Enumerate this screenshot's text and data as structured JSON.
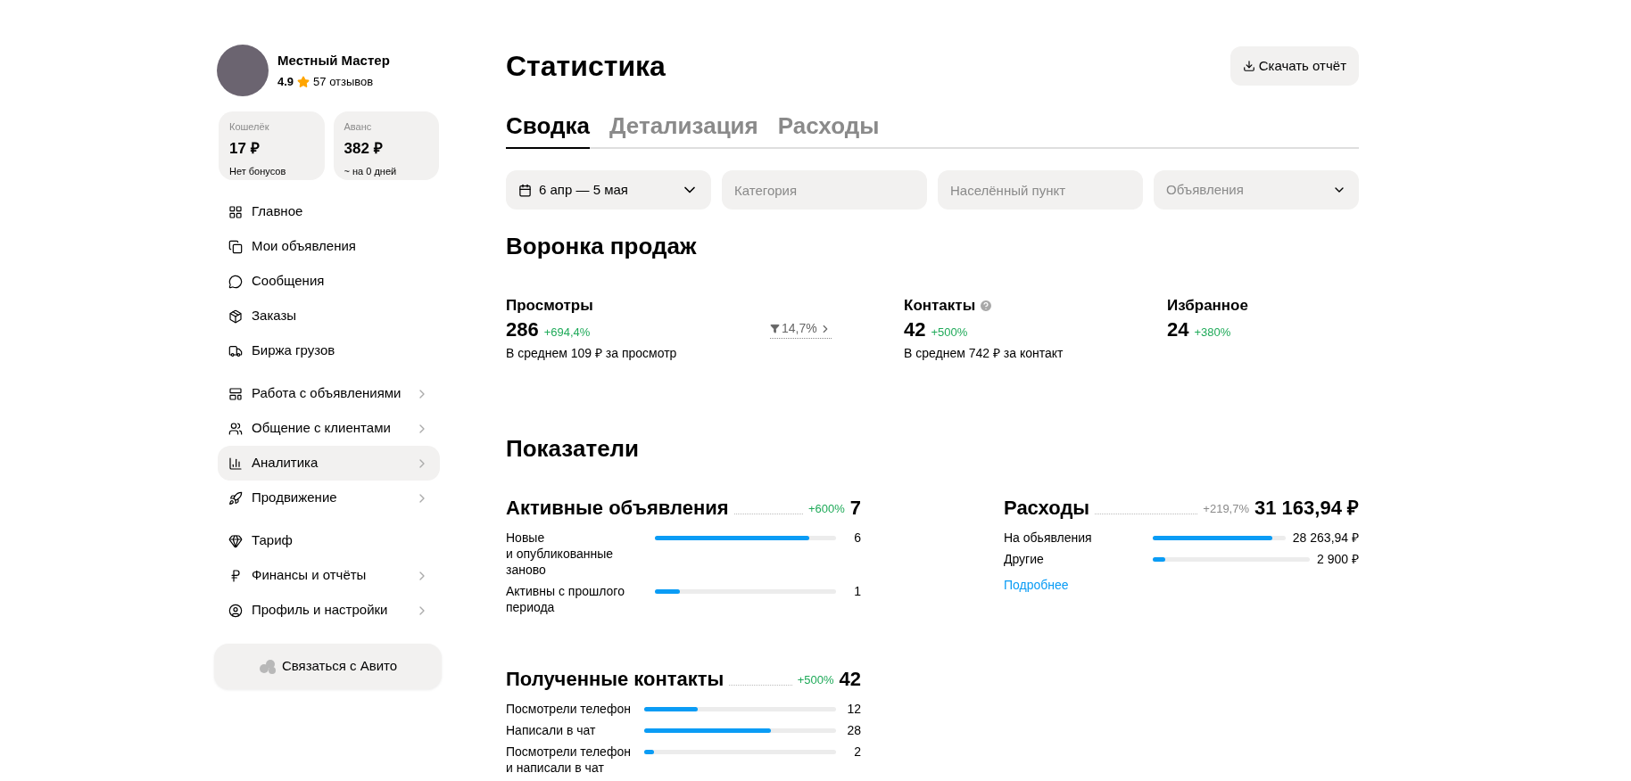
{
  "profile": {
    "name": "Местный Мастер",
    "rating": "4.9",
    "reviews": "57 отзывов"
  },
  "wallets": [
    {
      "label": "Кошелёк",
      "amount": "17 ₽",
      "note": "Нет бонусов"
    },
    {
      "label": "Аванс",
      "amount": "382 ₽",
      "note": "~ на 0 дней"
    }
  ],
  "nav_groups": [
    [
      {
        "label": "Главное",
        "selected": false,
        "expandable": false
      },
      {
        "label": "Мои объявления",
        "selected": false,
        "expandable": false
      },
      {
        "label": "Сообщения",
        "selected": false,
        "expandable": false
      },
      {
        "label": "Заказы",
        "selected": false,
        "expandable": false
      },
      {
        "label": "Биржа грузов",
        "selected": false,
        "expandable": false
      }
    ],
    [
      {
        "label": "Работа с объявлениями",
        "selected": false,
        "expandable": true
      },
      {
        "label": "Общение с клиентами",
        "selected": false,
        "expandable": true
      },
      {
        "label": "Аналитика",
        "selected": true,
        "expandable": true
      },
      {
        "label": "Продвижение",
        "selected": false,
        "expandable": true
      }
    ],
    [
      {
        "label": "Тариф",
        "selected": false,
        "expandable": false
      },
      {
        "label": "Финансы и отчёты",
        "selected": false,
        "expandable": true
      },
      {
        "label": "Профиль и настройки",
        "selected": false,
        "expandable": true
      }
    ]
  ],
  "contact_button": "Связаться с Авито",
  "title": "Статистика",
  "download_button": "Скачать отчёт",
  "tabs": [
    {
      "label": "Сводка",
      "selected": true
    },
    {
      "label": "Детализация",
      "selected": false
    },
    {
      "label": "Расходы",
      "selected": false
    }
  ],
  "filters": [
    {
      "kind": "date",
      "value": "6 апр — 5 мая"
    },
    {
      "kind": "input",
      "placeholder": "Категория"
    },
    {
      "kind": "input",
      "placeholder": "Населённый пункт"
    },
    {
      "kind": "select",
      "placeholder": "Объявления"
    }
  ],
  "funnel": {
    "title": "Воронка продаж",
    "conversion": "14,7%",
    "items": [
      {
        "label": "Просмотры",
        "value": "286",
        "change": "+694,4%",
        "note": "В среднем 109 ₽ за просмотр",
        "info": false
      },
      {
        "label": "Контакты",
        "value": "42",
        "change": "+500%",
        "note": "В среднем 742 ₽ за контакт",
        "info": true
      },
      {
        "label": "Избранное",
        "value": "24",
        "change": "+380%",
        "info": false
      }
    ]
  },
  "metrics": {
    "title": "Показатели",
    "sections": [
      {
        "title": "Активные объявления",
        "change": "+600%",
        "positive": true,
        "total": "7",
        "rows": [
          {
            "label": "Новые\nи опубликованные заново",
            "value": "6",
            "level": 0.85
          },
          {
            "label": "Активны с прошлого периода",
            "value": "1",
            "level": 0.14
          }
        ]
      },
      {
        "title": "Расходы",
        "change": "+219,7%",
        "positive": false,
        "total": "31 163,94 ₽",
        "link": "Подробнее",
        "rows": [
          {
            "label": "На обьявления",
            "value": "28 263,94 ₽",
            "level": 0.9
          },
          {
            "label": "Другие",
            "value": "2 900 ₽",
            "level": 0.08
          }
        ]
      },
      {
        "title": "Полученные контакты",
        "change": "+500%",
        "positive": true,
        "total": "42",
        "rows": [
          {
            "label": "Посмотрели телефон",
            "value": "12",
            "level": 0.28
          },
          {
            "label": "Написали в чат",
            "value": "28",
            "level": 0.66
          },
          {
            "label": "Посмотрели телефон и написали в чат",
            "value": "2",
            "level": 0.05
          }
        ]
      }
    ]
  }
}
